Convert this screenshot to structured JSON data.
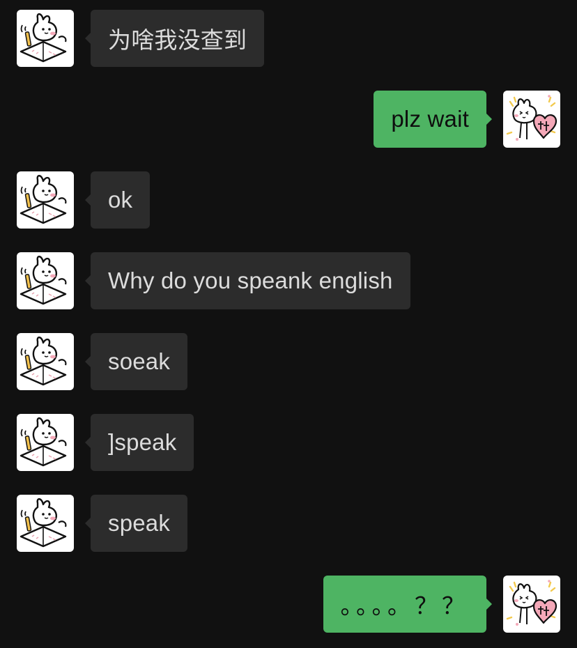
{
  "messages": [
    {
      "side": "in",
      "text": "为啥我没查到"
    },
    {
      "side": "out",
      "text": "plz wait"
    },
    {
      "side": "in",
      "text": "ok"
    },
    {
      "side": "in",
      "text": "Why do you speank english"
    },
    {
      "side": "in",
      "text": "soeak"
    },
    {
      "side": "in",
      "text": "]speak"
    },
    {
      "side": "in",
      "text": "speak"
    },
    {
      "side": "out",
      "text": "。。。。？？"
    }
  ],
  "colors": {
    "background": "#111111",
    "incoming_bubble": "#2c2c2c",
    "outgoing_bubble": "#4eb463"
  },
  "icons": {
    "contact_avatar": "rabbit-writing-avatar-icon",
    "self_avatar": "rabbit-heart-avatar-icon"
  }
}
